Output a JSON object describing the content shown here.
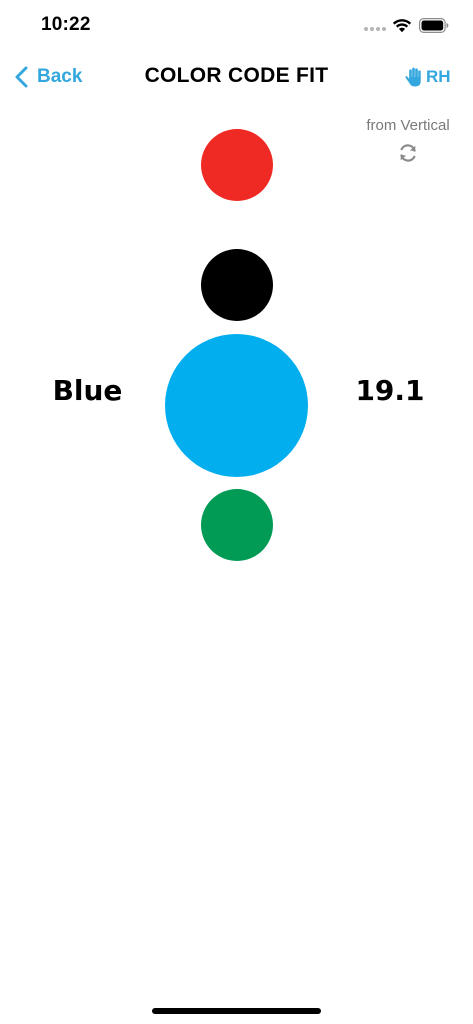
{
  "status_bar": {
    "time": "10:22",
    "icons": [
      "cellular-dots-icon",
      "wifi-icon",
      "battery-icon"
    ]
  },
  "nav": {
    "back_label": "Back",
    "title": "COLOR CODE FIT",
    "hand_label": "RH",
    "hand_icon": "hand-icon",
    "accent_color": "#34a7de"
  },
  "orientation": {
    "label": "from Vertical",
    "icon": "refresh-icon"
  },
  "colors": {
    "circles": [
      {
        "name": "red",
        "hex": "#ef2a24"
      },
      {
        "name": "black",
        "hex": "#000000"
      },
      {
        "name": "blue",
        "hex": "#03aeef"
      },
      {
        "name": "green",
        "hex": "#029b55"
      }
    ],
    "selected": {
      "name": "Blue",
      "value": "19.1"
    }
  }
}
